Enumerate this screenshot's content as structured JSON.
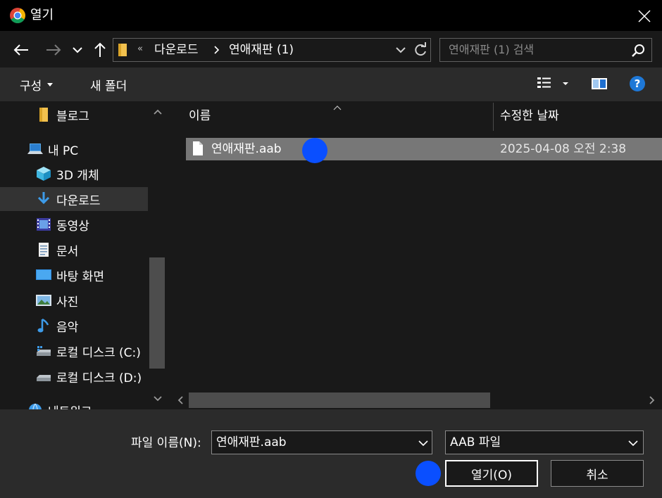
{
  "window": {
    "title": "열기"
  },
  "address": {
    "overflow": "«",
    "crumbs": [
      "다운로드",
      "연애재판 (1)"
    ]
  },
  "search": {
    "placeholder": "연애재판 (1) 검색"
  },
  "toolbar": {
    "organize_label": "구성",
    "new_folder_label": "새 폴더"
  },
  "nav": {
    "items": [
      {
        "label": "블로그",
        "icon": "folder-icon"
      },
      {
        "label": "내 PC",
        "icon": "pc-icon"
      },
      {
        "label": "3D 개체",
        "icon": "cube-icon"
      },
      {
        "label": "다운로드",
        "icon": "download-icon",
        "selected": true
      },
      {
        "label": "동영상",
        "icon": "video-icon"
      },
      {
        "label": "문서",
        "icon": "document-icon"
      },
      {
        "label": "바탕 화면",
        "icon": "desktop-icon"
      },
      {
        "label": "사진",
        "icon": "picture-icon"
      },
      {
        "label": "음악",
        "icon": "music-icon"
      },
      {
        "label": "로컬 디스크 (C:)",
        "icon": "drive-c-icon"
      },
      {
        "label": "로컬 디스크 (D:)",
        "icon": "drive-d-icon"
      },
      {
        "label": "네트워크",
        "icon": "network-icon"
      }
    ]
  },
  "files": {
    "columns": {
      "name": "이름",
      "date": "수정한 날짜"
    },
    "rows": [
      {
        "name": "연애재판.aab",
        "date": "2025-04-08 오전 2:38",
        "selected": true
      }
    ]
  },
  "footer": {
    "filename_label": "파일 이름(N):",
    "filename_value": "연애재판.aab",
    "filetype_value": "AAB 파일",
    "open_label": "열기(O)",
    "cancel_label": "취소"
  },
  "colors": {
    "background": "#191919",
    "titlebar": "#000000",
    "bar": "#2b2b2b",
    "selected_row": "#777777",
    "selected_nav": "#333333",
    "marker": "#0a4fff",
    "help": "#1e78d7"
  }
}
